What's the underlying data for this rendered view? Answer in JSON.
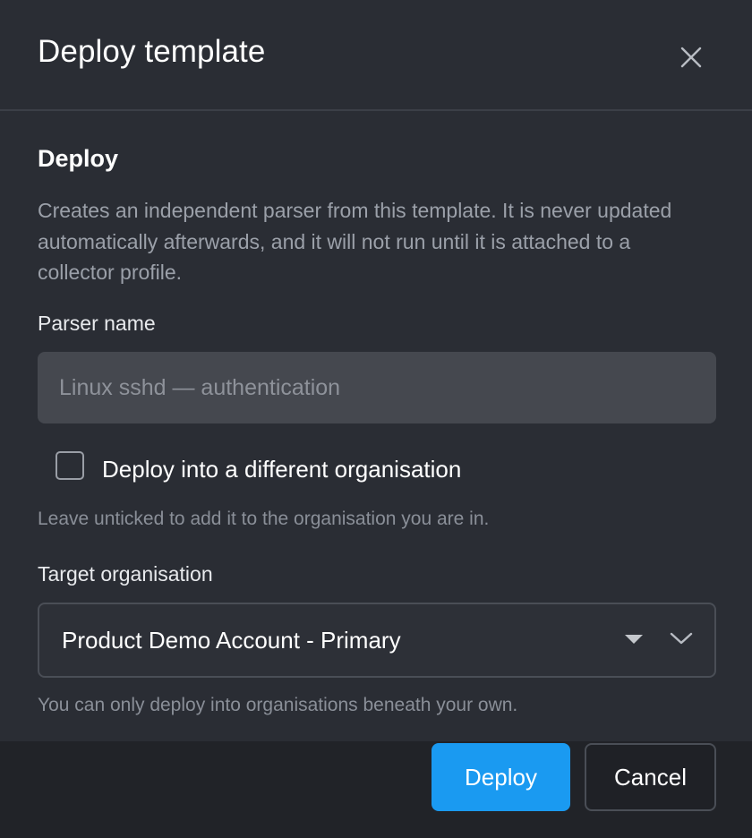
{
  "modal": {
    "title": "Deploy template"
  },
  "deploy_section": {
    "heading": "Deploy",
    "description": "Creates an independent parser from this template. It is never updated automatically afterwards, and it will not run until it is attached to a collector profile."
  },
  "parser_name": {
    "label": "Parser name",
    "value": "",
    "placeholder": "Linux sshd — authentication"
  },
  "different_org": {
    "checkbox_label": "Deploy into a different organisation",
    "checked": false,
    "hint": "Leave unticked to add it to the organisation you are in."
  },
  "target_org": {
    "label": "Target organisation",
    "selected": "Product Demo Account - Primary",
    "hint": "You can only deploy into organisations beneath your own."
  },
  "footer": {
    "deploy_label": "Deploy",
    "cancel_label": "Cancel"
  },
  "icons": {
    "close": "close-icon",
    "caret": "caret-down-icon",
    "chevron": "chevron-down-icon"
  },
  "colors": {
    "background": "#2a2d34",
    "footer_background": "#212328",
    "primary_button": "#1a9af1",
    "input_background": "#45484f"
  }
}
